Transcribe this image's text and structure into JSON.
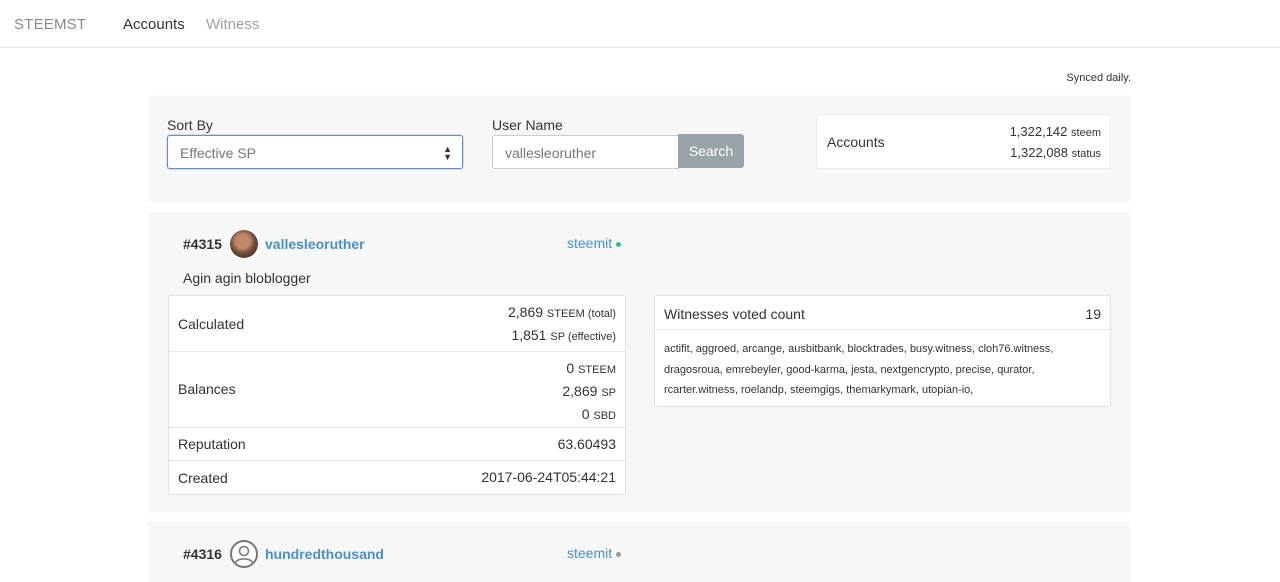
{
  "nav": {
    "brand": "STEEMST",
    "links": [
      "Accounts",
      "Witness"
    ]
  },
  "synced": "Synced daily.",
  "search": {
    "sort_label": "Sort By",
    "sort_value": "Effective SP",
    "username_label": "User Name",
    "username_value": "vallesleoruther",
    "search_button": "Search"
  },
  "stats": {
    "label": "Accounts",
    "steem_count": "1,322,142",
    "steem_unit": "steem",
    "status_count": "1,322,088",
    "status_unit": "status"
  },
  "accounts": [
    {
      "rank": "#4315",
      "username": "vallesleoruther",
      "link": "steemit",
      "status_color": "#2ebd8c",
      "about": "Agin agin bloblogger",
      "calculated": {
        "label": "Calculated",
        "total_value": "2,869",
        "total_unit": "STEEM (total)",
        "effective_value": "1,851",
        "effective_unit": "SP (effective)"
      },
      "balances": {
        "label": "Balances",
        "steem_value": "0",
        "steem_unit": "STEEM",
        "sp_value": "2,869",
        "sp_unit": "SP",
        "sbd_value": "0",
        "sbd_unit": "SBD"
      },
      "reputation": {
        "label": "Reputation",
        "value": "63.60493"
      },
      "created": {
        "label": "Created",
        "value": "2017-06-24T05:44:21"
      },
      "witnesses": {
        "title": "Witnesses voted count",
        "count": "19",
        "list": "actifit, aggroed, arcange, ausbitbank, blocktrades, busy.witness, cloh76.witness, dragosroua, emrebeyler, good-karma, jesta, nextgencrypto, precise, qurator, rcarter.witness, roelandp, steemgigs, themarkymark, utopian-io,"
      }
    },
    {
      "rank": "#4316",
      "username": "hundredthousand",
      "link": "steemit",
      "status_color": "#999999"
    }
  ]
}
